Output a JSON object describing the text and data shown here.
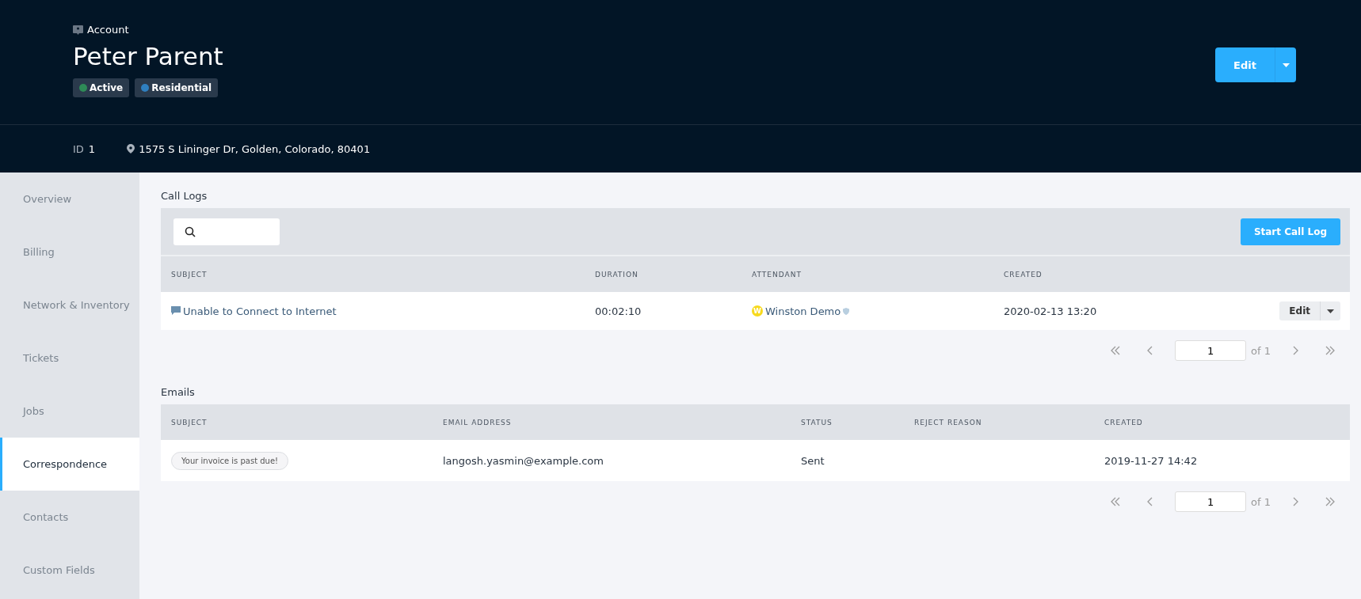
{
  "header": {
    "kind_label": "Account",
    "name": "Peter Parent",
    "tags": [
      {
        "label": "Active",
        "color": "#2e8b57"
      },
      {
        "label": "Residential",
        "color": "#2f7fbf"
      }
    ],
    "edit_button": "Edit",
    "id_label": "ID",
    "id_value": "1",
    "address": "1575 S Lininger Dr, Golden, Colorado, 80401"
  },
  "sidebar": {
    "items": [
      {
        "label": "Overview",
        "selected": false
      },
      {
        "label": "Billing",
        "selected": false
      },
      {
        "label": "Network & Inventory",
        "selected": false
      },
      {
        "label": "Tickets",
        "selected": false
      },
      {
        "label": "Jobs",
        "selected": false
      },
      {
        "label": "Correspondence",
        "selected": true
      },
      {
        "label": "Contacts",
        "selected": false
      },
      {
        "label": "Custom Fields",
        "selected": false
      }
    ]
  },
  "call_logs": {
    "title": "Call Logs",
    "start_button": "Start Call Log",
    "columns": [
      "SUBJECT",
      "DURATION",
      "ATTENDANT",
      "CREATED"
    ],
    "rows": [
      {
        "subject": "Unable to Connect to Internet",
        "duration": "00:02:10",
        "attendant_initial": "W",
        "attendant": "Winston Demo",
        "created": "2020-02-13 13:20",
        "action": "Edit"
      }
    ],
    "pagination": {
      "page": "1",
      "of": "of 1"
    }
  },
  "emails": {
    "title": "Emails",
    "columns": [
      "SUBJECT",
      "EMAIL ADDRESS",
      "STATUS",
      "REJECT REASON",
      "CREATED"
    ],
    "rows": [
      {
        "subject": "Your invoice is past due!",
        "email": "langosh.yasmin@example.com",
        "status": "Sent",
        "created": "2019-11-27 14:42"
      }
    ],
    "pagination": {
      "page": "1",
      "of": "of 1"
    }
  }
}
